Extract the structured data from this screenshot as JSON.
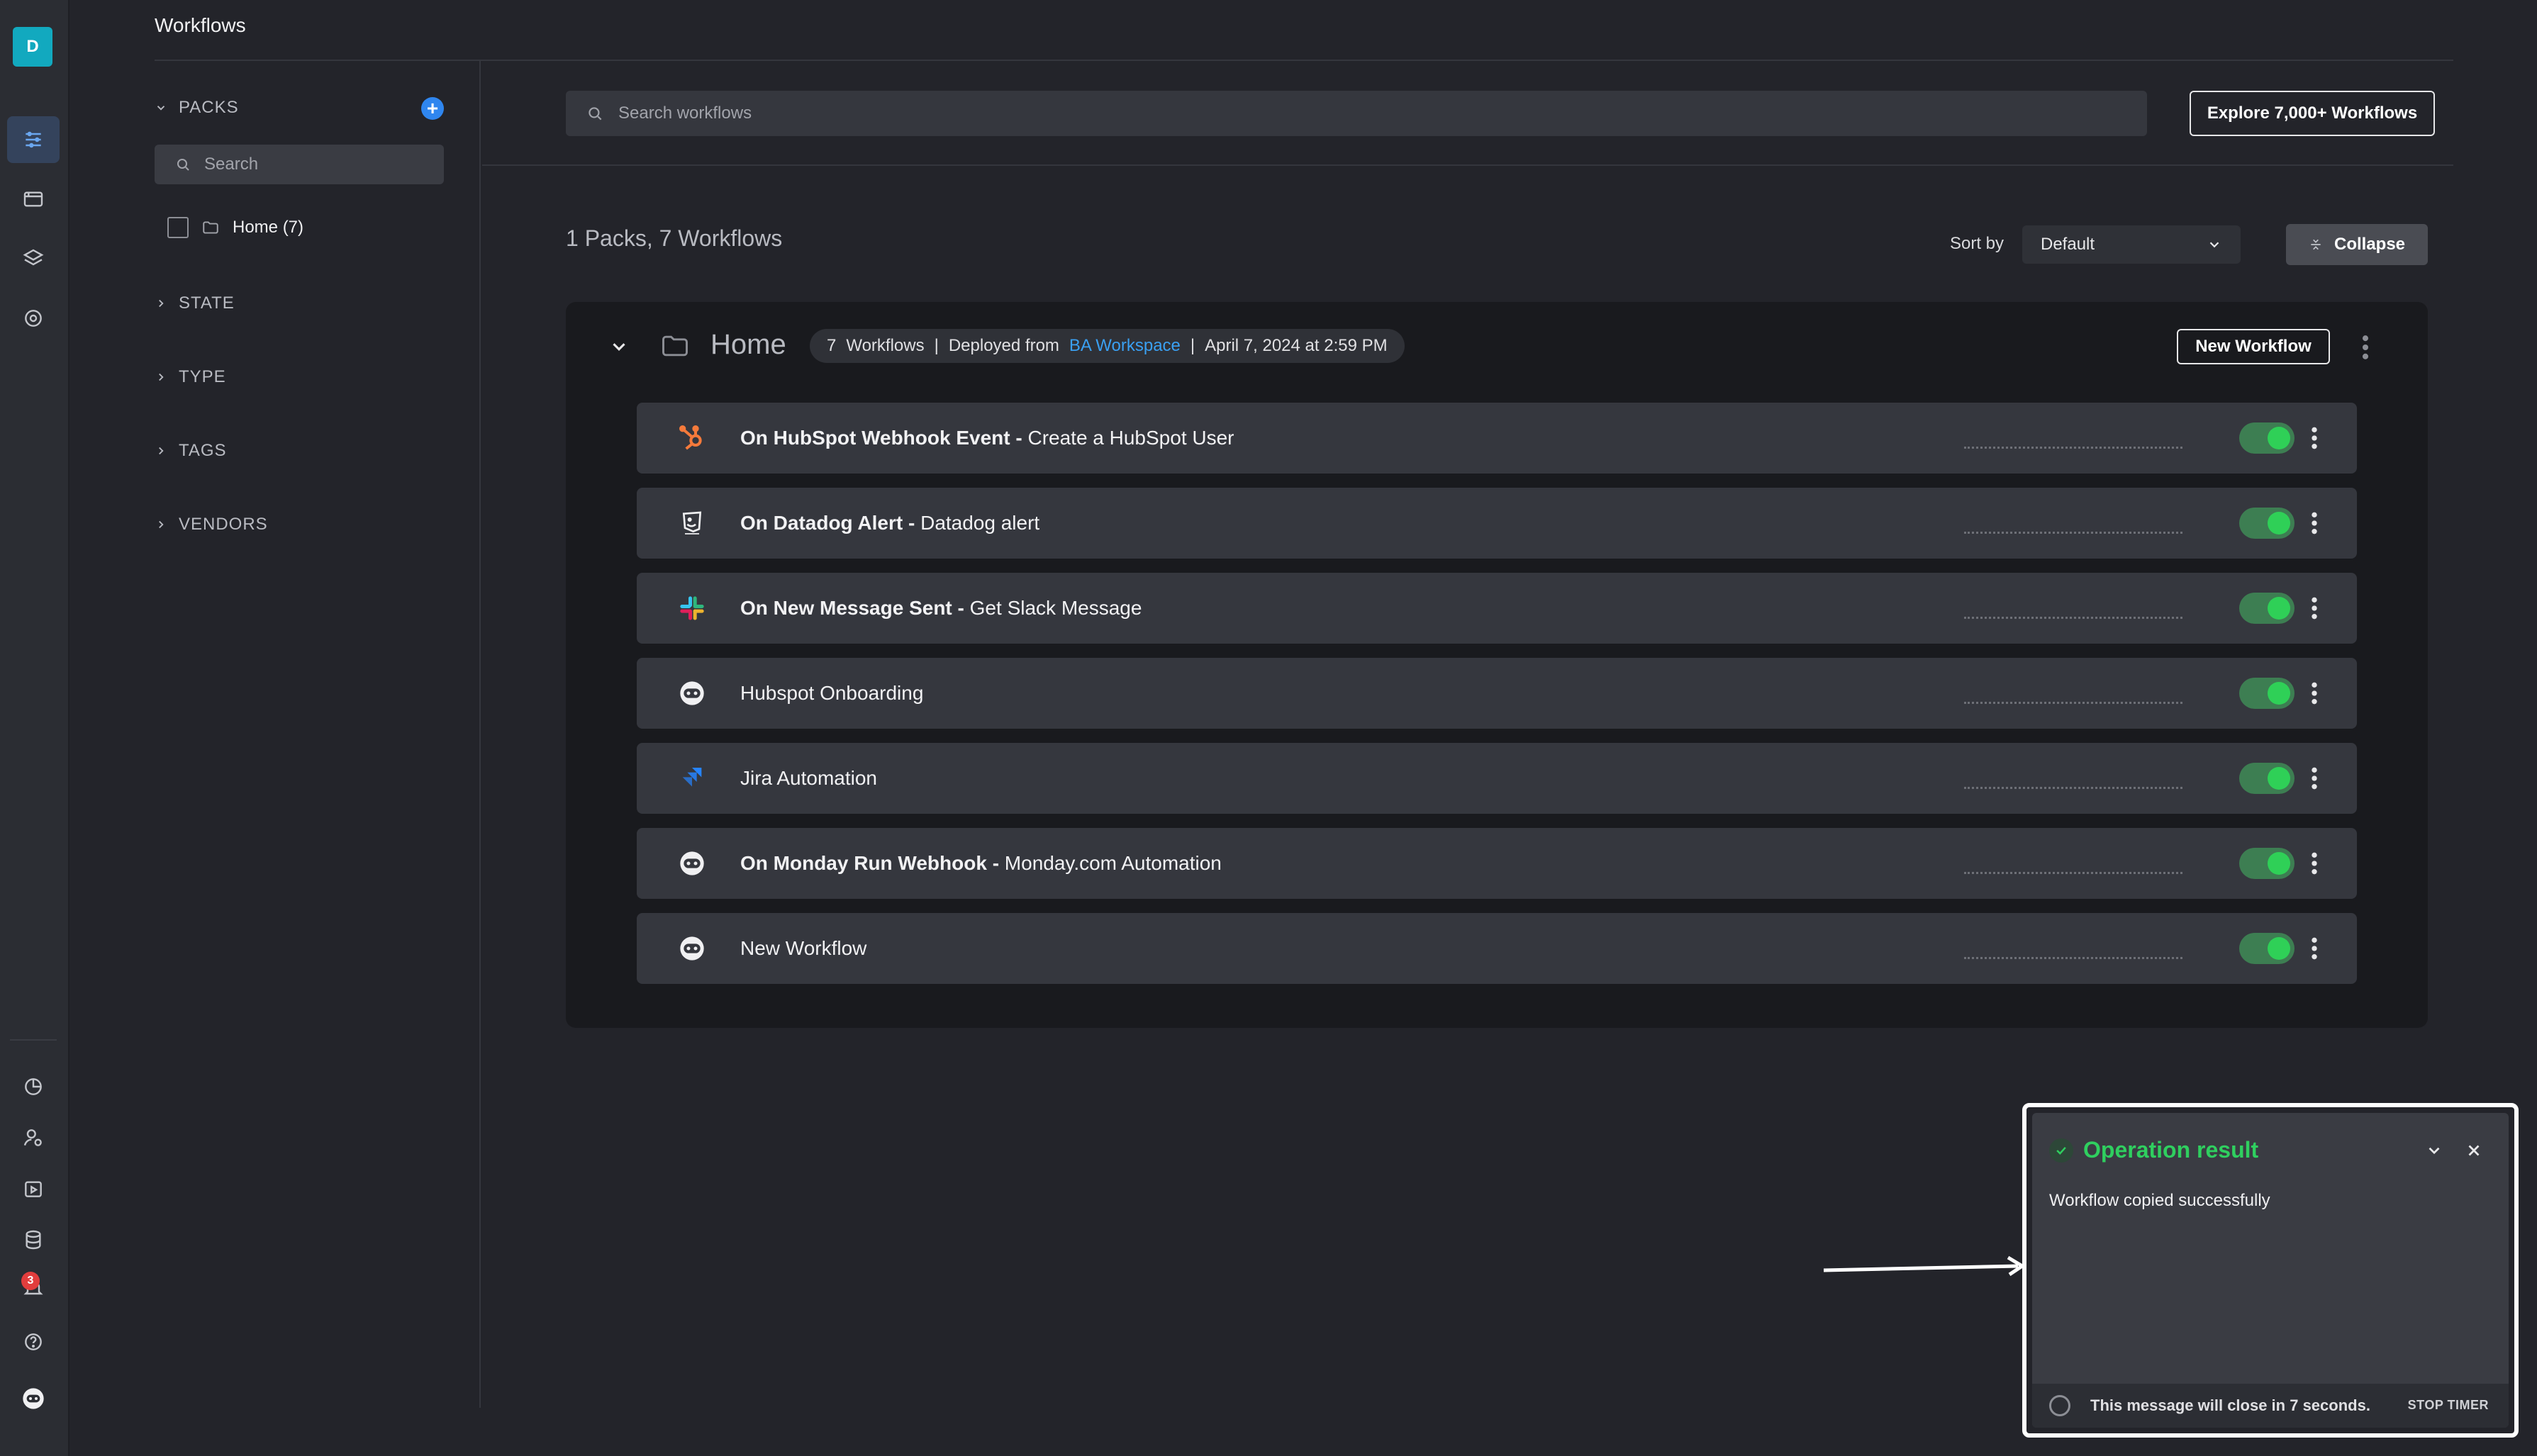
{
  "app": {
    "avatar_letter": "D",
    "title": "Workflows",
    "notification_count": "3"
  },
  "filters": {
    "packs_label": "PACKS",
    "search_placeholder": "Search",
    "pack_items": [
      {
        "label": "Home (7)"
      }
    ],
    "sections": [
      "STATE",
      "TYPE",
      "TAGS",
      "VENDORS"
    ]
  },
  "main": {
    "search_placeholder": "Search workflows",
    "explore_label": "Explore 7,000+ Workflows",
    "summary": "1 Packs, 7 Workflows",
    "sort_label": "Sort by",
    "sort_value": "Default",
    "collapse_label": "Collapse"
  },
  "pack": {
    "name": "Home",
    "count": "7",
    "workflows_word": "Workflows",
    "deployed_from_label": "Deployed from",
    "workspace": "BA Workspace",
    "date": "April 7, 2024 at 2:59 PM",
    "new_workflow_label": "New Workflow"
  },
  "workflows": [
    {
      "bold": "On HubSpot Webhook Event -",
      "rest": "Create a HubSpot User",
      "icon": "hubspot-icon",
      "enabled": true
    },
    {
      "bold": "On Datadog Alert -",
      "rest": "Datadog alert",
      "icon": "datadog-icon",
      "enabled": true
    },
    {
      "bold": "On New Message Sent -",
      "rest": "Get Slack Message",
      "icon": "slack-icon",
      "enabled": true
    },
    {
      "bold": "",
      "rest": "Hubspot Onboarding",
      "icon": "bot-icon",
      "enabled": true
    },
    {
      "bold": "",
      "rest": "Jira Automation",
      "icon": "jira-icon",
      "enabled": true
    },
    {
      "bold": "On Monday Run Webhook -",
      "rest": "Monday.com Automation",
      "icon": "bot-icon",
      "enabled": true
    },
    {
      "bold": "",
      "rest": "New Workflow",
      "icon": "bot-icon",
      "enabled": true
    }
  ],
  "toast": {
    "title": "Operation result",
    "message": "Workflow copied successfully",
    "timer_text": "This message will close in 7 seconds.",
    "stop_label": "STOP TIMER"
  },
  "colors": {
    "accent_blue": "#2f86ef",
    "success_green": "#2fcf5f",
    "link_blue": "#3aa0f2",
    "avatar_teal": "#12a9bf"
  }
}
